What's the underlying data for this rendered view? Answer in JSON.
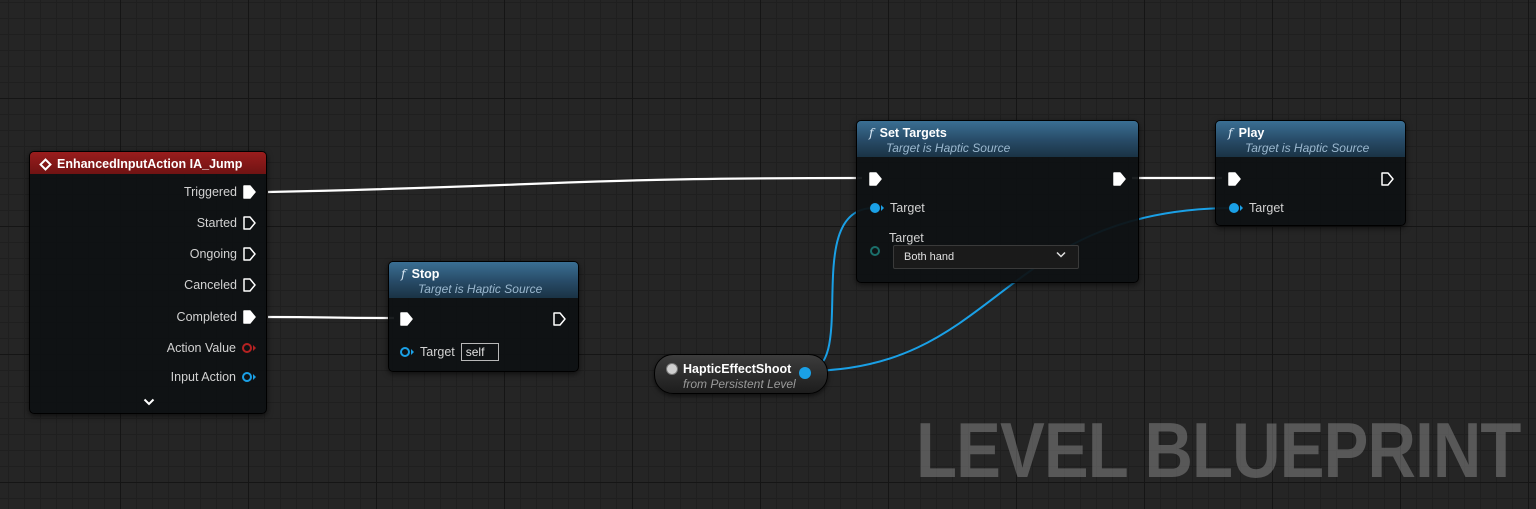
{
  "watermark": "LEVEL BLUEPRINT",
  "event_node": {
    "title": "EnhancedInputAction IA_Jump",
    "outputs": [
      "Triggered",
      "Started",
      "Ongoing",
      "Canceled",
      "Completed",
      "Action Value",
      "Input Action"
    ],
    "expand_icon": "chevron-down-icon"
  },
  "stop_node": {
    "title": "Stop",
    "subtitle": "Target is Haptic Source",
    "target_label": "Target",
    "target_value": "self"
  },
  "set_targets_node": {
    "title": "Set Targets",
    "subtitle": "Target is Haptic Source",
    "target_label": "Target",
    "targets_label": "Target",
    "dropdown_value": "Both hand"
  },
  "play_node": {
    "title": "Play",
    "subtitle": "Target is Haptic Source",
    "target_label": "Target"
  },
  "variable_node": {
    "name": "HapticEffectShoot",
    "subtitle": "from Persistent Level"
  },
  "colors": {
    "function_header": "#2f5f80",
    "event_header": "#8a1a1a",
    "object_pin": "#1aa0e6",
    "exec_wire": "#ffffff",
    "struct_pin": "#b52222"
  }
}
